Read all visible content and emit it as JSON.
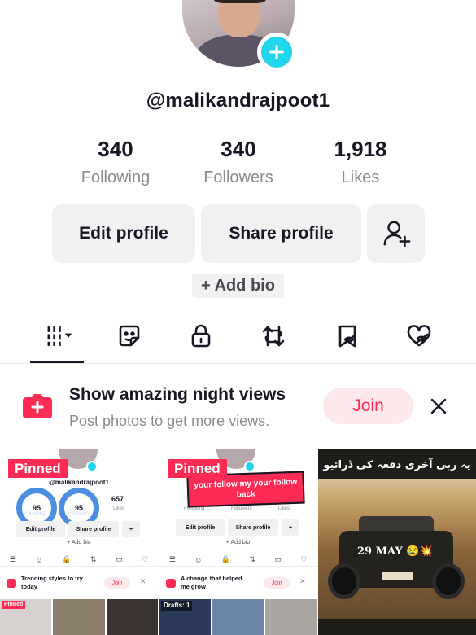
{
  "profile": {
    "username": "@malikandrajpoot1",
    "stats": [
      {
        "value": "340",
        "label": "Following"
      },
      {
        "value": "340",
        "label": "Followers"
      },
      {
        "value": "1,918",
        "label": "Likes"
      }
    ],
    "buttons": {
      "edit": "Edit profile",
      "share": "Share profile"
    },
    "add_bio": "+ Add bio"
  },
  "tabs": [
    {
      "icon": "grid-icon",
      "active": true
    },
    {
      "icon": "sticker-icon"
    },
    {
      "icon": "lock-icon"
    },
    {
      "icon": "repost-icon"
    },
    {
      "icon": "bookmark-hidden-icon"
    },
    {
      "icon": "liked-hidden-icon"
    }
  ],
  "promo": {
    "title": "Show amazing night views",
    "subtitle": "Post photos to get more views.",
    "join": "Join"
  },
  "videos": [
    {
      "pinned": "Pinned",
      "mini": {
        "username": "@malikandrajpoot1",
        "ring1": "95",
        "ring2": "95",
        "likes": "657",
        "ring1_label": "Following",
        "ring2_label": "Followers",
        "likes_label": "Likes",
        "edit": "Edit profile",
        "share": "Share profile",
        "bio": "+ Add bio",
        "promo_title": "Trending styles to try today",
        "promo_join": "Join",
        "strip_tag": "Pinned"
      }
    },
    {
      "pinned": "Pinned",
      "sticker": "your follow my your follow back",
      "mini": {
        "edit": "Edit profile",
        "share": "Share profile",
        "following_label": "Following",
        "followers_label": "Followers",
        "likes_label": "Likes",
        "bio": "+ Add bio",
        "promo_title": "A change that helped me grow",
        "promo_join": "Join",
        "strip_tag": "Drafts: 1"
      }
    },
    {
      "caption_top": "یہ ربی آخری دفعہ کی ڈرائیو",
      "caption_mid": "29 MAY 😢💥"
    }
  ],
  "colors": {
    "accent": "#fe2c55",
    "badge": "#20d5ec",
    "text": "#161823",
    "muted": "#8a8b91",
    "button_bg": "#f1f1f2"
  }
}
